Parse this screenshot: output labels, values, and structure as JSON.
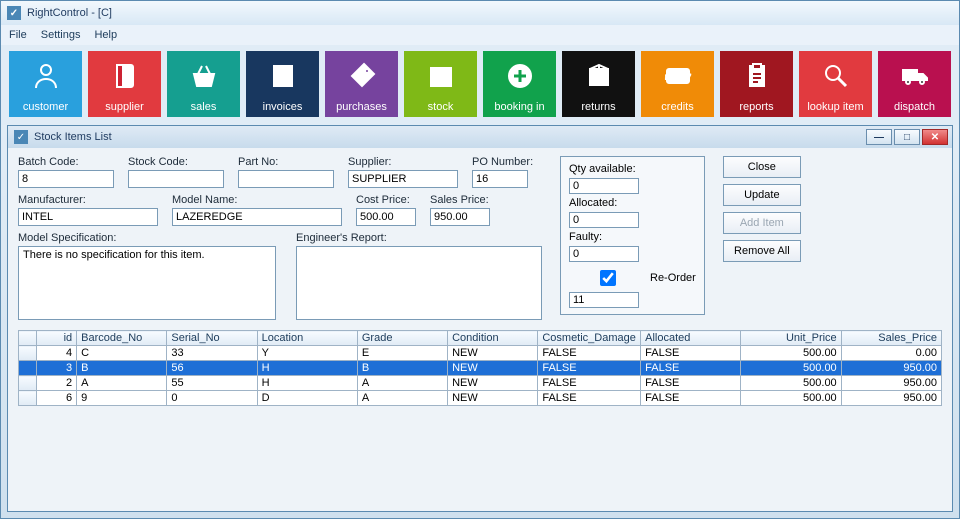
{
  "window": {
    "title": "RightControl - [C]"
  },
  "menu": {
    "file": "File",
    "settings": "Settings",
    "help": "Help"
  },
  "toolbar": [
    {
      "label": "customer",
      "name": "customer",
      "color": "c-blue",
      "icon": "user"
    },
    {
      "label": "supplier",
      "name": "supplier",
      "color": "c-red",
      "icon": "book"
    },
    {
      "label": "sales",
      "name": "sales",
      "color": "c-teal",
      "icon": "basket"
    },
    {
      "label": "invoices",
      "name": "invoices",
      "color": "c-dkblue",
      "icon": "files"
    },
    {
      "label": "purchases",
      "name": "purchases",
      "color": "c-purple",
      "icon": "tag"
    },
    {
      "label": "stock",
      "name": "stock",
      "color": "c-green",
      "icon": "gift"
    },
    {
      "label": "booking in",
      "name": "booking-in",
      "color": "c-lime",
      "icon": "plus"
    },
    {
      "label": "returns",
      "name": "returns",
      "color": "c-black",
      "icon": "box"
    },
    {
      "label": "credits",
      "name": "credits",
      "color": "c-orange",
      "icon": "card"
    },
    {
      "label": "reports",
      "name": "reports",
      "color": "c-dkred",
      "icon": "clip"
    },
    {
      "label": "lookup item",
      "name": "lookup-item",
      "color": "c-red",
      "icon": "search"
    },
    {
      "label": "dispatch",
      "name": "dispatch",
      "color": "c-maroon",
      "icon": "truck"
    }
  ],
  "inner": {
    "title": "Stock Items List"
  },
  "winbtns": {
    "min": "—",
    "max": "□",
    "close": "✕"
  },
  "form": {
    "batch_code": {
      "label": "Batch Code:",
      "value": "8"
    },
    "stock_code": {
      "label": "Stock Code:",
      "value": ""
    },
    "part_no": {
      "label": "Part No:",
      "value": ""
    },
    "supplier": {
      "label": "Supplier:",
      "value": "SUPPLIER"
    },
    "po_number": {
      "label": "PO Number:",
      "value": "16"
    },
    "manufacturer": {
      "label": "Manufacturer:",
      "value": "INTEL"
    },
    "model_name": {
      "label": "Model Name:",
      "value": "LAZEREDGE"
    },
    "cost_price": {
      "label": "Cost Price:",
      "value": "500.00"
    },
    "sales_price": {
      "label": "Sales Price:",
      "value": "950.00"
    },
    "model_spec": {
      "label": "Model Specification:",
      "value": "There is no specification for this item."
    },
    "eng_report": {
      "label": "Engineer's Report:",
      "value": ""
    }
  },
  "side": {
    "qty_available": {
      "label": "Qty available:",
      "value": "0"
    },
    "allocated": {
      "label": "Allocated:",
      "value": "0"
    },
    "faulty": {
      "label": "Faulty:",
      "value": "0"
    },
    "reorder": {
      "label": "Re-Order",
      "checked": true,
      "value": "11"
    }
  },
  "buttons": {
    "close": "Close",
    "update": "Update",
    "add_item": "Add Item",
    "remove_all": "Remove All"
  },
  "grid": {
    "headers": [
      "id",
      "Barcode_No",
      "Serial_No",
      "Location",
      "Grade",
      "Condition",
      "Cosmetic_Damage",
      "Allocated",
      "Unit_Price",
      "Sales_Price"
    ],
    "rows": [
      {
        "sel": false,
        "cells": [
          "4",
          "C",
          "33",
          "Y",
          "E",
          "NEW",
          "FALSE",
          "FALSE",
          "500.00",
          "0.00"
        ]
      },
      {
        "sel": true,
        "cells": [
          "3",
          "B",
          "56",
          "H",
          "B",
          "NEW",
          "FALSE",
          "FALSE",
          "500.00",
          "950.00"
        ]
      },
      {
        "sel": false,
        "cells": [
          "2",
          "A",
          "55",
          "H",
          "A",
          "NEW",
          "FALSE",
          "FALSE",
          "500.00",
          "950.00"
        ]
      },
      {
        "sel": false,
        "cells": [
          "6",
          "9",
          "0",
          "D",
          "A",
          "NEW",
          "FALSE",
          "FALSE",
          "500.00",
          "950.00"
        ]
      }
    ],
    "numcols": [
      0,
      8,
      9
    ]
  }
}
